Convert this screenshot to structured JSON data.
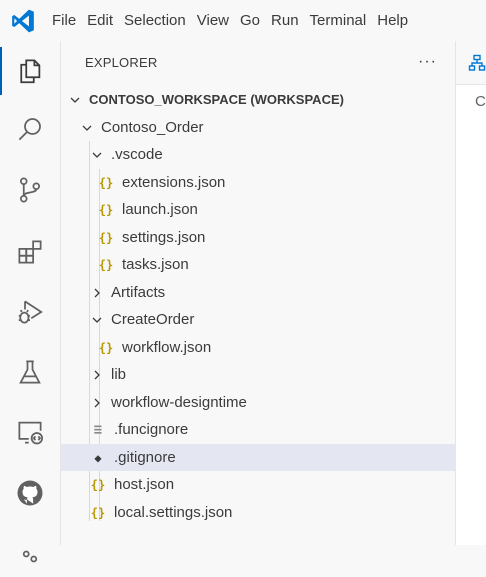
{
  "menu": [
    "File",
    "Edit",
    "Selection",
    "View",
    "Go",
    "Run",
    "Terminal",
    "Help"
  ],
  "activity_bar": [
    {
      "name": "explorer-icon",
      "active": true
    },
    {
      "name": "search-icon",
      "active": false
    },
    {
      "name": "source-control-icon",
      "active": false
    },
    {
      "name": "extensions-icon",
      "active": false
    },
    {
      "name": "run-debug-icon",
      "active": false
    },
    {
      "name": "testing-icon",
      "active": false
    },
    {
      "name": "remote-explorer-icon",
      "active": false
    },
    {
      "name": "github-icon",
      "active": false
    },
    {
      "name": "more-icon",
      "active": false
    }
  ],
  "sidebar": {
    "title": "EXPLORER",
    "more": "···",
    "workspace": "CONTOSO_WORKSPACE (WORKSPACE)",
    "tree": [
      {
        "label": "Contoso_Order",
        "kind": "folder-open",
        "depth": 1
      },
      {
        "label": ".vscode",
        "kind": "folder-open",
        "depth": 2
      },
      {
        "label": "extensions.json",
        "kind": "json",
        "depth": 3
      },
      {
        "label": "launch.json",
        "kind": "json",
        "depth": 3
      },
      {
        "label": "settings.json",
        "kind": "json",
        "depth": 3
      },
      {
        "label": "tasks.json",
        "kind": "json",
        "depth": 3
      },
      {
        "label": "Artifacts",
        "kind": "folder-closed",
        "depth": 2
      },
      {
        "label": "CreateOrder",
        "kind": "folder-open",
        "depth": 2
      },
      {
        "label": "workflow.json",
        "kind": "json",
        "depth": 3
      },
      {
        "label": "lib",
        "kind": "folder-closed",
        "depth": 2
      },
      {
        "label": "workflow-designtime",
        "kind": "folder-closed",
        "depth": 2
      },
      {
        "label": ".funcignore",
        "kind": "text",
        "depth": 2
      },
      {
        "label": ".gitignore",
        "kind": "git",
        "depth": 2,
        "selected": true
      },
      {
        "label": "host.json",
        "kind": "json",
        "depth": 2
      },
      {
        "label": "local.settings.json",
        "kind": "json",
        "depth": 2
      }
    ]
  },
  "editor": {
    "partial_text": "C"
  },
  "icons": {
    "json": "{}",
    "text": "≡",
    "git": "◆"
  },
  "colors": {
    "accent": "#005fb8",
    "json": "#b79800",
    "selected_row": "#e4e6f1"
  }
}
